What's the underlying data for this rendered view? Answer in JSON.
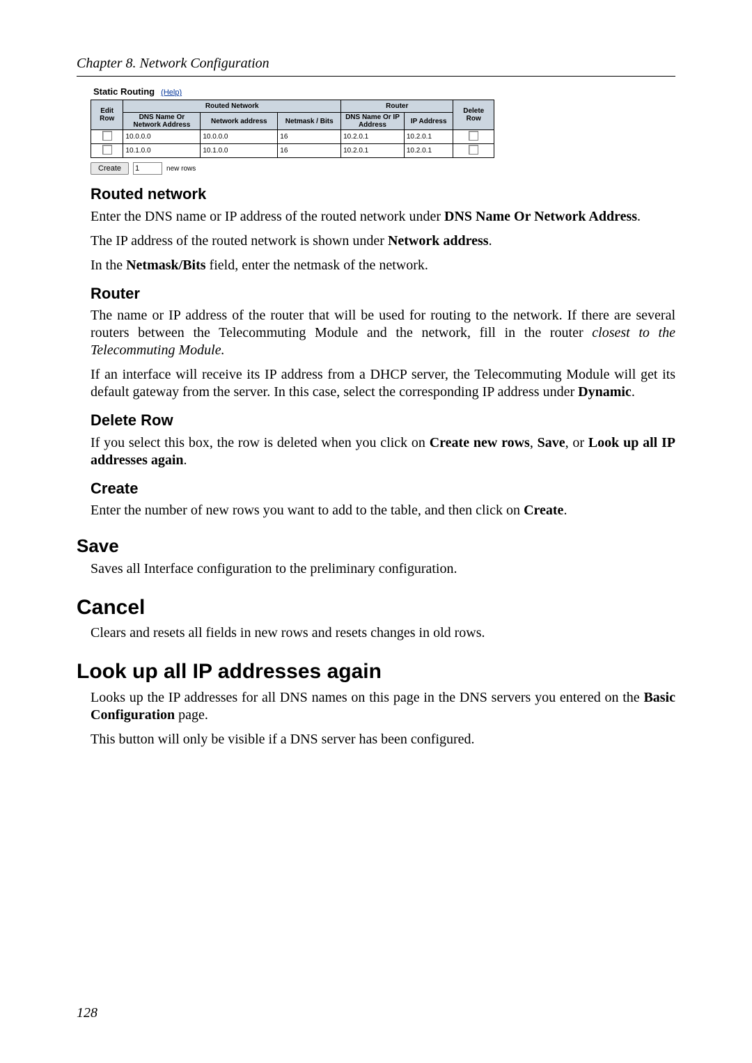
{
  "chapter_header": "Chapter 8. Network Configuration",
  "screenshot": {
    "title": "Static Routing",
    "help": "(Help)",
    "group_routed": "Routed Network",
    "group_router": "Router",
    "headers": {
      "edit_row": "Edit Row",
      "dns_name_addr": "DNS Name Or Network Address",
      "network_address": "Network address",
      "netmask_bits": "Netmask / Bits",
      "router_dns": "DNS Name Or IP Address",
      "router_ip": "IP Address",
      "delete_row": "Delete Row"
    },
    "rows": [
      {
        "dns": "10.0.0.0",
        "net": "10.0.0.0",
        "mask": "16",
        "rdns": "10.2.0.1",
        "rip": "10.2.0.1"
      },
      {
        "dns": "10.1.0.0",
        "net": "10.1.0.0",
        "mask": "16",
        "rdns": "10.2.0.1",
        "rip": "10.2.0.1"
      }
    ],
    "create_btn": "Create",
    "create_count": "1",
    "new_rows": "new rows"
  },
  "sections": {
    "routed_network": {
      "title": "Routed network",
      "p1a": "Enter the DNS name or IP address of the routed network under ",
      "p1b": "DNS Name Or Network Address",
      "p1c": ".",
      "p2a": "The IP address of the routed network is shown under ",
      "p2b": "Network address",
      "p2c": ".",
      "p3a": "In the ",
      "p3b": "Netmask/Bits",
      "p3c": " field, enter the netmask of the network."
    },
    "router": {
      "title": "Router",
      "p1a": "The name or IP address of the router that will be used for routing to the network. If there are several routers between the Telecommuting Module and the network, fill in the router ",
      "p1b": "closest to the Telecommuting Module.",
      "p2a": "If an interface will receive its IP address from a DHCP server, the Telecommuting Module will get its default gateway from the server. In this case, select the corresponding IP address under ",
      "p2b": "Dynamic",
      "p2c": "."
    },
    "delete_row": {
      "title": "Delete Row",
      "p1a": "If you select this box, the row is deleted when you click on ",
      "p1b": "Create new rows",
      "p1c": ", ",
      "p1d": "Save",
      "p1e": ", or ",
      "p1f": "Look up all IP addresses again",
      "p1g": "."
    },
    "create": {
      "title": "Create",
      "p1a": "Enter the number of new rows you want to add to the table, and then click on ",
      "p1b": "Create",
      "p1c": "."
    },
    "save": {
      "title": "Save",
      "p1": "Saves all Interface configuration to the preliminary configuration."
    },
    "cancel": {
      "title": "Cancel",
      "p1": "Clears and resets all fields in new rows and resets changes in old rows."
    },
    "lookup": {
      "title": "Look up all IP addresses again",
      "p1a": "Looks up the IP addresses for all DNS names on this page in the DNS servers you entered on the ",
      "p1b": "Basic Configuration",
      "p1c": " page.",
      "p2": "This button will only be visible if a DNS server has been configured."
    }
  },
  "page_number": "128"
}
